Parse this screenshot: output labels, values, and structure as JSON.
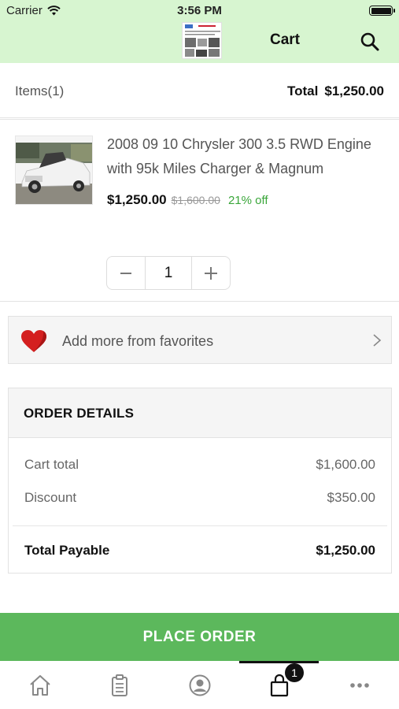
{
  "status_bar": {
    "carrier": "Carrier",
    "time": "3:56 PM"
  },
  "header": {
    "title": "Cart"
  },
  "summary": {
    "items_label": "Items(1)",
    "total_label": "Total",
    "total_value": "$1,250.00"
  },
  "cart_item": {
    "name": "2008 09 10 Chrysler 300 3.5 RWD Engine with 95k Miles Charger & Magnum",
    "price": "$1,250.00",
    "mrp": "$1,600.00",
    "discount": "21% off",
    "quantity": "1"
  },
  "favorites": {
    "label": "Add more from favorites"
  },
  "order_details": {
    "title": "ORDER DETAILS",
    "cart_total_label": "Cart total",
    "cart_total_value": "$1,600.00",
    "discount_label": "Discount",
    "discount_value": "$350.00",
    "payable_label": "Total Payable",
    "payable_value": "$1,250.00"
  },
  "place_order": "PLACE ORDER",
  "tabbar": {
    "items": [
      {
        "icon": "home-icon"
      },
      {
        "icon": "clipboard-icon"
      },
      {
        "icon": "profile-icon"
      },
      {
        "icon": "cart-bag-icon",
        "badge": "1",
        "active": true
      },
      {
        "icon": "more-icon"
      }
    ]
  },
  "colors": {
    "header_bg": "#d7f5d0",
    "accent_green": "#5cb85c",
    "discount_green": "#3aa63a",
    "heart_red": "#d41f1f"
  }
}
